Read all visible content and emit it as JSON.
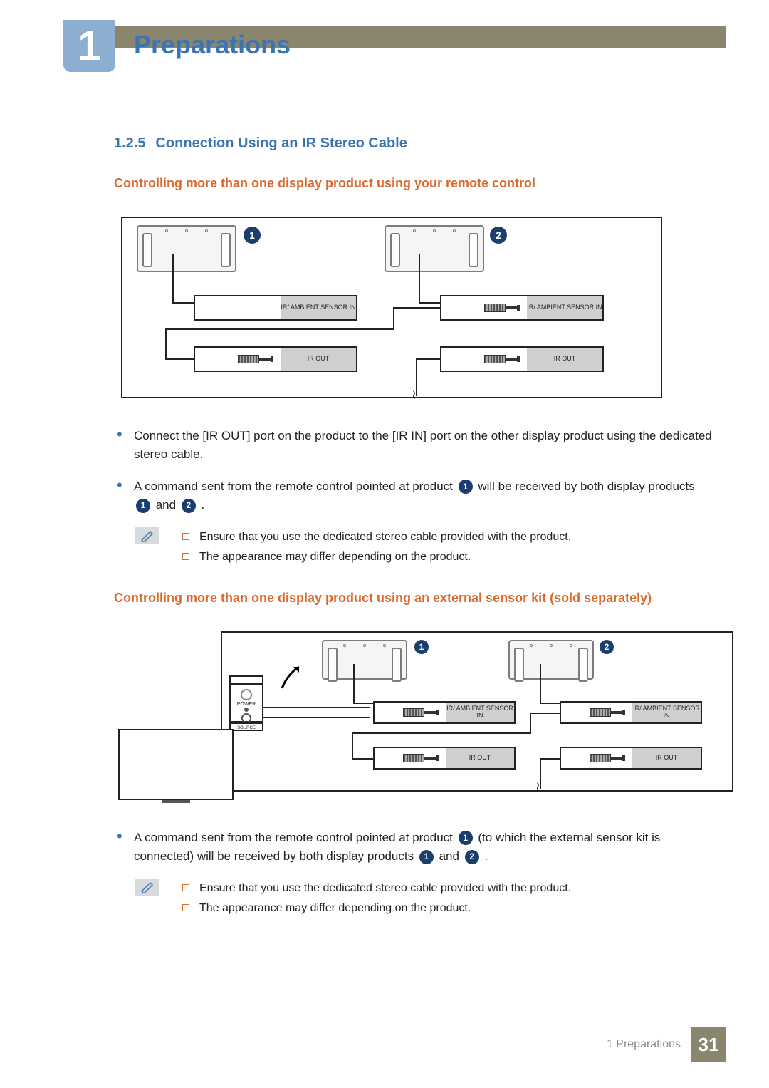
{
  "chapter": {
    "number": "1",
    "title": "Preparations"
  },
  "section": {
    "number": "1.2.5",
    "title": "Connection Using an IR Stereo Cable"
  },
  "subsections": {
    "one": "Controlling more than one display product using your remote control",
    "two": "Controlling more than one display product using an external sensor kit (sold separately)"
  },
  "port_labels": {
    "sensor_in": "IR/\nAMBIENT\nSENSOR IN",
    "ir_out": "IR OUT"
  },
  "remote_labels": {
    "power": "POWER",
    "source": "SOURCE"
  },
  "callouts": {
    "one": "1",
    "two": "2"
  },
  "bullets1": {
    "b1": "Connect the [IR OUT] port on the product to the [IR IN] port on the other display product using the dedicated stereo cable.",
    "b2a": "A command sent from the remote control pointed at product ",
    "b2b": " will be received by both display products ",
    "b2c": " and ",
    "b2d": " ."
  },
  "notes": {
    "n1": "Ensure that you use the dedicated stereo cable provided with the product.",
    "n2": "The appearance may differ depending on the product."
  },
  "bullets2": {
    "b1a": "A command sent from the remote control pointed at product ",
    "b1b": " (to which the external sensor kit is connected) will be received by both display products ",
    "b1c": " and ",
    "b1d": " ."
  },
  "footer": {
    "chapter_ref": "1 Preparations",
    "page": "31"
  }
}
